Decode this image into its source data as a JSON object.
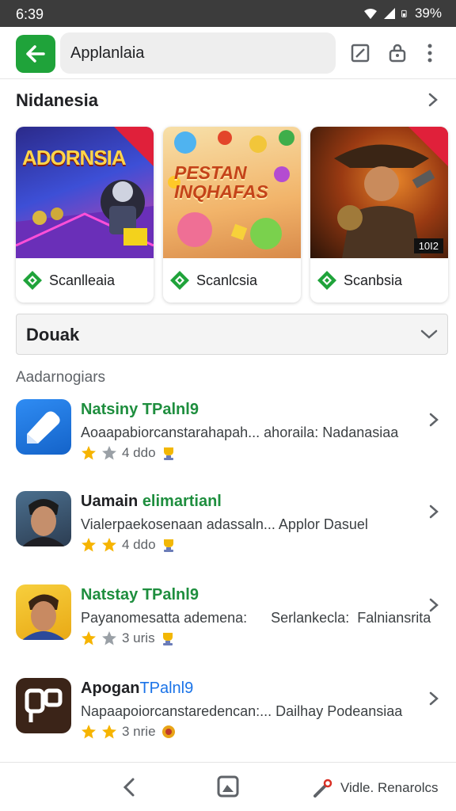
{
  "status_bar": {
    "time": "6:39",
    "battery": "39%"
  },
  "top_bar": {
    "search_text": "Applanlaia"
  },
  "section_featured": {
    "title": "Nidanesia",
    "cards": [
      {
        "art_title": "ADORNSIA",
        "badge": "",
        "label": "Scanlleaia"
      },
      {
        "art_title": "PESTAN INQHAFAS",
        "badge": "",
        "label": "Scanlcsia"
      },
      {
        "art_title": "",
        "badge": "10I2",
        "label": "Scanbsia"
      }
    ]
  },
  "dropdown": {
    "label": "Douak"
  },
  "list_section": {
    "label": "Aadarnogiars",
    "items": [
      {
        "title_a": "Natsiny TPalnl9",
        "title_b": "",
        "title_color": "#1e8e3e",
        "desc": "Aoaapabiorcanstarahapah... ahoraila: Nadanasiaa",
        "rating": "4 ddo",
        "stars_filled": 1
      },
      {
        "title_a": "Uamain ",
        "title_b": "elimartianl",
        "title_color": "#202124",
        "desc": "Vialerpaekosenaan adassaln... Applor Dasuel",
        "rating": "4 ddo",
        "stars_filled": 2
      },
      {
        "title_a": "Natstay TPalnl9",
        "title_b": "",
        "title_color": "#1e8e3e",
        "desc": "Payanomesatta ademena:      Serlankecla:  Falniansrita",
        "rating": "3 uris",
        "stars_filled": 1
      },
      {
        "title_a": "Apogan",
        "title_b": "TPalnl9",
        "title_color": "#202124",
        "desc": "Napaapoiorcanstaredencan:... Dailhay Podeansiaa",
        "rating": "3 nrie",
        "stars_filled": 2
      }
    ]
  },
  "bottom_nav": {
    "extra_label": "Vidle. Renarolcs"
  },
  "colors": {
    "accent_green": "#1fa33a",
    "title_blue": "#1a73e8",
    "star_gold": "#f6b400"
  },
  "icons": [
    "wifi-icon",
    "signal-icon",
    "battery-icon",
    "back-arrow-icon",
    "edit-square-icon",
    "lock-bag-icon",
    "more-vert-icon",
    "chevron-right-icon",
    "chevron-down-icon",
    "star-icon",
    "trophy-icon",
    "nav-back-icon",
    "nav-home-icon",
    "nav-pin-icon"
  ]
}
